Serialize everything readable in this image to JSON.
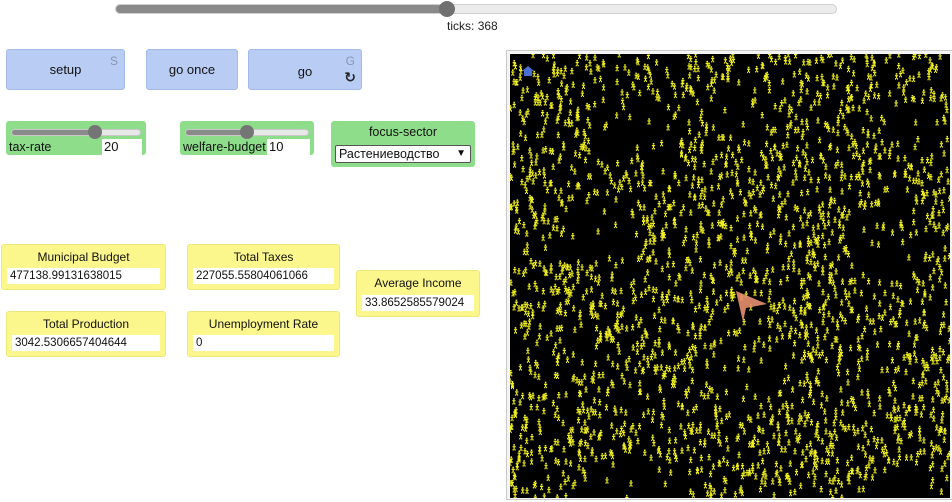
{
  "speed_slider": {
    "fraction": 0.46
  },
  "ticks": {
    "label": "ticks:",
    "value": "368"
  },
  "buttons": {
    "setup": {
      "label": "setup",
      "key": "S"
    },
    "go_once": {
      "label": "go once"
    },
    "go": {
      "label": "go",
      "key": "G",
      "forever_icon": "↻"
    }
  },
  "sliders": {
    "tax_rate": {
      "label": "tax-rate",
      "value": "20",
      "fraction": 0.65
    },
    "welfare_budget": {
      "label": "welfare-budget",
      "value": "10",
      "fraction": 0.5
    }
  },
  "chooser": {
    "label": "focus-sector",
    "selected": "Растениеводство",
    "arrow": "⌄"
  },
  "monitors": {
    "municipal_budget": {
      "label": "Municipal Budget",
      "value": "477138.99131638015"
    },
    "total_taxes": {
      "label": "Total Taxes",
      "value": "227055.55804061066"
    },
    "average_income": {
      "label": "Average Income",
      "value": "33.8652585579024"
    },
    "total_production": {
      "label": "Total Production",
      "value": "3042.5306657404644"
    },
    "unemployment_rate": {
      "label": "Unemployment Rate",
      "value": "0"
    }
  },
  "world": {
    "background": "#000000",
    "agent_color": "#f0f020",
    "cursor_color": "#e89070",
    "home_icon": "home-icon"
  }
}
